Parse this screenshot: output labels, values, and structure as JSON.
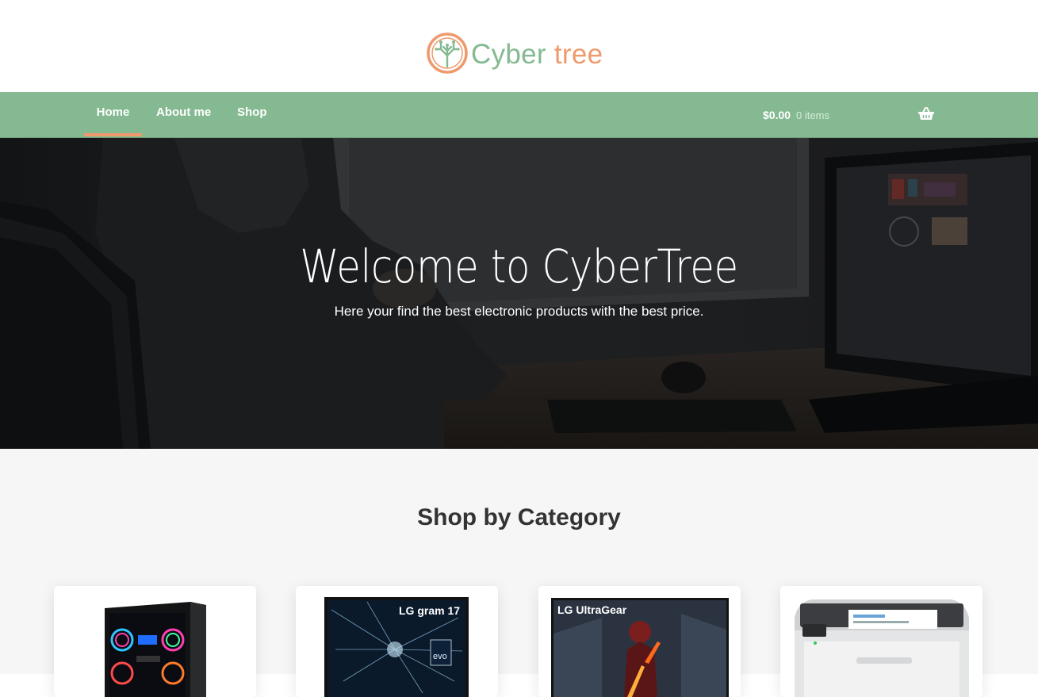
{
  "brand": {
    "word1": "Cyber",
    "word2": "tree",
    "logo_icon": "circuit-tree-icon",
    "green": "#84b991",
    "orange": "#ee9a6c"
  },
  "nav": {
    "items": [
      {
        "label": "Home",
        "active": true
      },
      {
        "label": "About me"
      },
      {
        "label": "Shop"
      }
    ]
  },
  "cart": {
    "amount": "$0.00",
    "count": "0 items",
    "icon": "basket-icon"
  },
  "hero": {
    "title": "Welcome to CyberTree",
    "subtitle": "Here your find the best electronic products with the best price."
  },
  "categories": {
    "heading": "Shop by Category",
    "cards": [
      {
        "image": "gaming-pc-tower-image"
      },
      {
        "image": "lg-gram-laptop-image",
        "image_text": "LG gram 17"
      },
      {
        "image": "lg-ultragear-monitor-image",
        "image_text": "LG UltraGear"
      },
      {
        "image": "laser-printer-image"
      }
    ]
  }
}
